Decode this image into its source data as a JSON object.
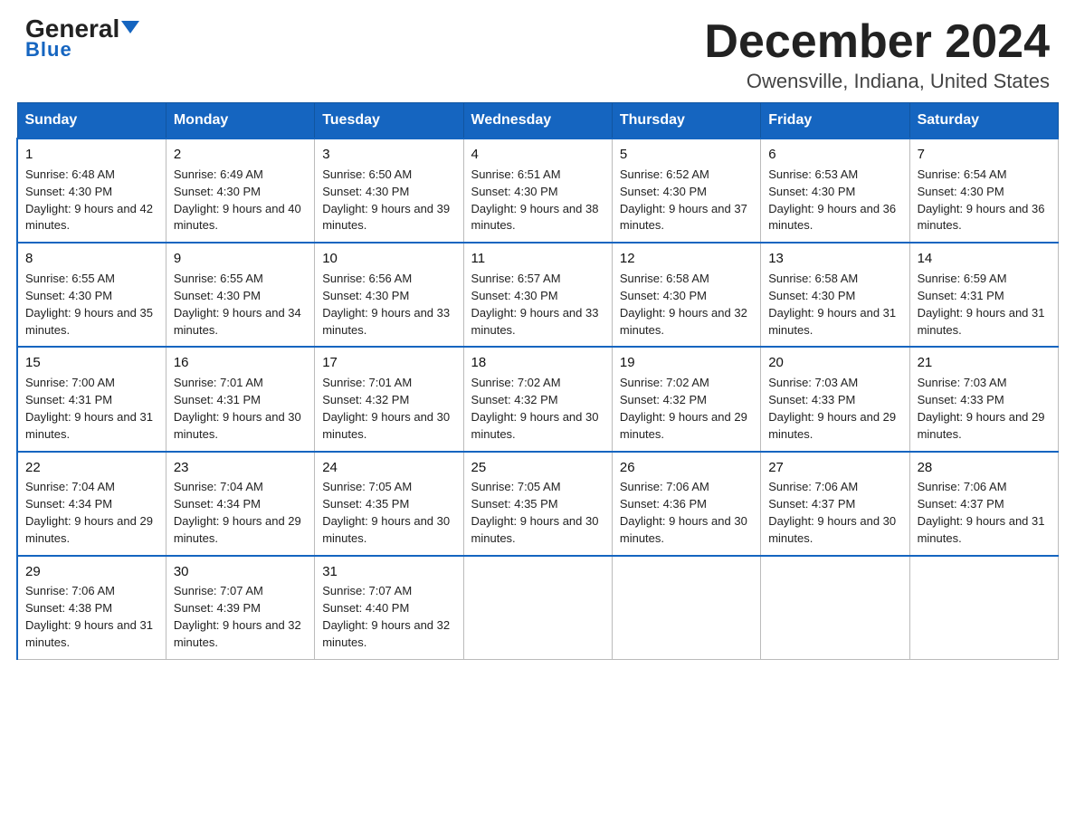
{
  "header": {
    "logo_general": "General",
    "logo_blue": "Blue",
    "month_title": "December 2024",
    "location": "Owensville, Indiana, United States"
  },
  "days_of_week": [
    "Sunday",
    "Monday",
    "Tuesday",
    "Wednesday",
    "Thursday",
    "Friday",
    "Saturday"
  ],
  "weeks": [
    [
      {
        "day": "1",
        "sunrise": "6:48 AM",
        "sunset": "4:30 PM",
        "daylight": "9 hours and 42 minutes."
      },
      {
        "day": "2",
        "sunrise": "6:49 AM",
        "sunset": "4:30 PM",
        "daylight": "9 hours and 40 minutes."
      },
      {
        "day": "3",
        "sunrise": "6:50 AM",
        "sunset": "4:30 PM",
        "daylight": "9 hours and 39 minutes."
      },
      {
        "day": "4",
        "sunrise": "6:51 AM",
        "sunset": "4:30 PM",
        "daylight": "9 hours and 38 minutes."
      },
      {
        "day": "5",
        "sunrise": "6:52 AM",
        "sunset": "4:30 PM",
        "daylight": "9 hours and 37 minutes."
      },
      {
        "day": "6",
        "sunrise": "6:53 AM",
        "sunset": "4:30 PM",
        "daylight": "9 hours and 36 minutes."
      },
      {
        "day": "7",
        "sunrise": "6:54 AM",
        "sunset": "4:30 PM",
        "daylight": "9 hours and 36 minutes."
      }
    ],
    [
      {
        "day": "8",
        "sunrise": "6:55 AM",
        "sunset": "4:30 PM",
        "daylight": "9 hours and 35 minutes."
      },
      {
        "day": "9",
        "sunrise": "6:55 AM",
        "sunset": "4:30 PM",
        "daylight": "9 hours and 34 minutes."
      },
      {
        "day": "10",
        "sunrise": "6:56 AM",
        "sunset": "4:30 PM",
        "daylight": "9 hours and 33 minutes."
      },
      {
        "day": "11",
        "sunrise": "6:57 AM",
        "sunset": "4:30 PM",
        "daylight": "9 hours and 33 minutes."
      },
      {
        "day": "12",
        "sunrise": "6:58 AM",
        "sunset": "4:30 PM",
        "daylight": "9 hours and 32 minutes."
      },
      {
        "day": "13",
        "sunrise": "6:58 AM",
        "sunset": "4:30 PM",
        "daylight": "9 hours and 31 minutes."
      },
      {
        "day": "14",
        "sunrise": "6:59 AM",
        "sunset": "4:31 PM",
        "daylight": "9 hours and 31 minutes."
      }
    ],
    [
      {
        "day": "15",
        "sunrise": "7:00 AM",
        "sunset": "4:31 PM",
        "daylight": "9 hours and 31 minutes."
      },
      {
        "day": "16",
        "sunrise": "7:01 AM",
        "sunset": "4:31 PM",
        "daylight": "9 hours and 30 minutes."
      },
      {
        "day": "17",
        "sunrise": "7:01 AM",
        "sunset": "4:32 PM",
        "daylight": "9 hours and 30 minutes."
      },
      {
        "day": "18",
        "sunrise": "7:02 AM",
        "sunset": "4:32 PM",
        "daylight": "9 hours and 30 minutes."
      },
      {
        "day": "19",
        "sunrise": "7:02 AM",
        "sunset": "4:32 PM",
        "daylight": "9 hours and 29 minutes."
      },
      {
        "day": "20",
        "sunrise": "7:03 AM",
        "sunset": "4:33 PM",
        "daylight": "9 hours and 29 minutes."
      },
      {
        "day": "21",
        "sunrise": "7:03 AM",
        "sunset": "4:33 PM",
        "daylight": "9 hours and 29 minutes."
      }
    ],
    [
      {
        "day": "22",
        "sunrise": "7:04 AM",
        "sunset": "4:34 PM",
        "daylight": "9 hours and 29 minutes."
      },
      {
        "day": "23",
        "sunrise": "7:04 AM",
        "sunset": "4:34 PM",
        "daylight": "9 hours and 29 minutes."
      },
      {
        "day": "24",
        "sunrise": "7:05 AM",
        "sunset": "4:35 PM",
        "daylight": "9 hours and 30 minutes."
      },
      {
        "day": "25",
        "sunrise": "7:05 AM",
        "sunset": "4:35 PM",
        "daylight": "9 hours and 30 minutes."
      },
      {
        "day": "26",
        "sunrise": "7:06 AM",
        "sunset": "4:36 PM",
        "daylight": "9 hours and 30 minutes."
      },
      {
        "day": "27",
        "sunrise": "7:06 AM",
        "sunset": "4:37 PM",
        "daylight": "9 hours and 30 minutes."
      },
      {
        "day": "28",
        "sunrise": "7:06 AM",
        "sunset": "4:37 PM",
        "daylight": "9 hours and 31 minutes."
      }
    ],
    [
      {
        "day": "29",
        "sunrise": "7:06 AM",
        "sunset": "4:38 PM",
        "daylight": "9 hours and 31 minutes."
      },
      {
        "day": "30",
        "sunrise": "7:07 AM",
        "sunset": "4:39 PM",
        "daylight": "9 hours and 32 minutes."
      },
      {
        "day": "31",
        "sunrise": "7:07 AM",
        "sunset": "4:40 PM",
        "daylight": "9 hours and 32 minutes."
      },
      null,
      null,
      null,
      null
    ]
  ],
  "labels": {
    "sunrise_prefix": "Sunrise: ",
    "sunset_prefix": "Sunset: ",
    "daylight_prefix": "Daylight: "
  }
}
